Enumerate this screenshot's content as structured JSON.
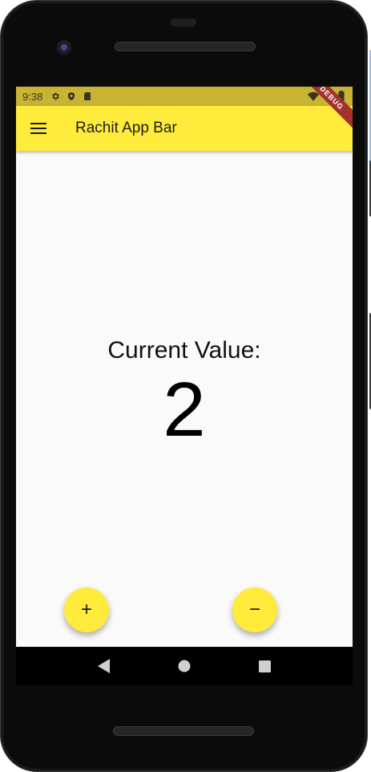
{
  "status_bar": {
    "time": "9:38",
    "icons": [
      "settings-icon",
      "shield-icon",
      "sd-card-icon",
      "wifi-icon",
      "signal-icon",
      "battery-icon"
    ]
  },
  "debug_banner": "DEBUG",
  "app_bar": {
    "menu_icon": "hamburger-menu-icon",
    "title": "Rachit App Bar",
    "color": "#ffeb3b"
  },
  "main": {
    "label": "Current Value:",
    "value": "2"
  },
  "fabs": {
    "increment_symbol": "+",
    "decrement_symbol": "−",
    "color": "#ffeb3b"
  },
  "nav_bar": {
    "items": [
      "back-icon",
      "home-icon",
      "recents-icon"
    ]
  }
}
